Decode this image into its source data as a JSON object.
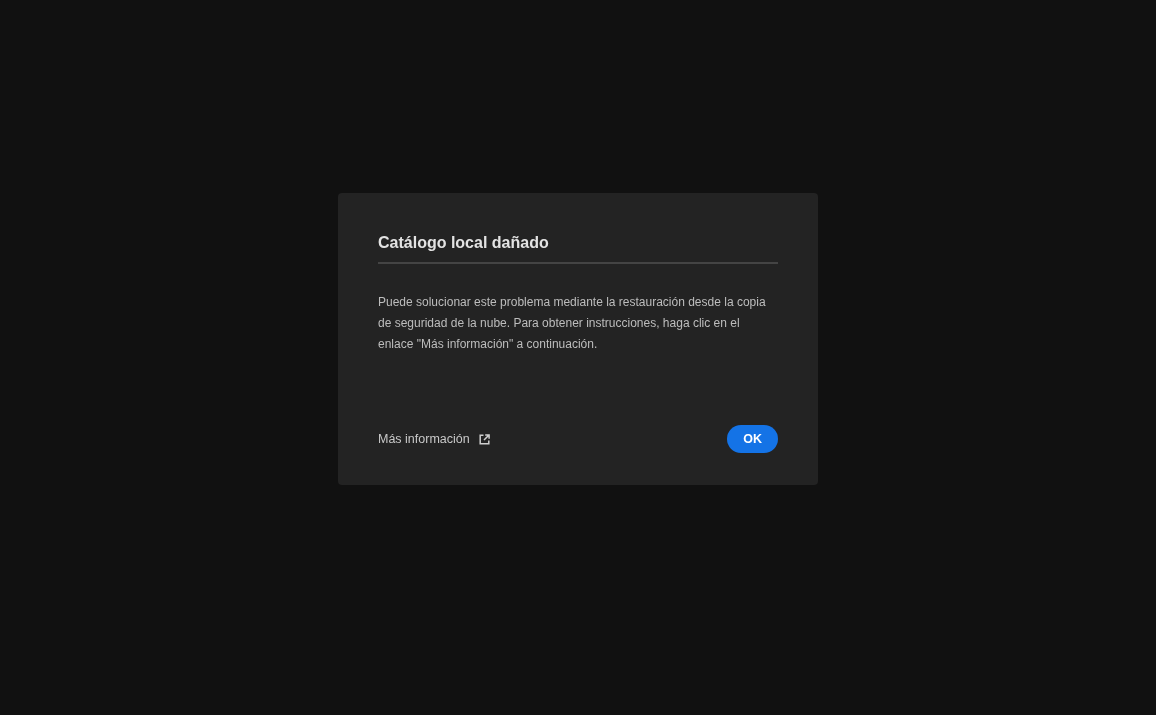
{
  "dialog": {
    "title": "Catálogo local dañado",
    "message": "Puede solucionar este problema mediante la restauración desde la copia de seguridad de la nube. Para obtener instrucciones, haga clic en el enlace \"Más información\" a continuación.",
    "link": {
      "label": "Más información"
    },
    "buttons": [
      {
        "label": "OK",
        "kind": "primary"
      }
    ]
  }
}
